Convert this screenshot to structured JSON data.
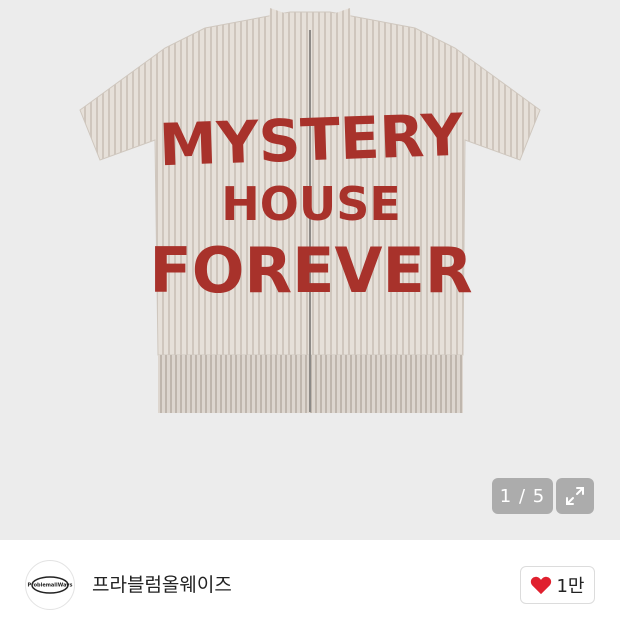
{
  "gallery": {
    "shirt_text_lines": [
      "MYSTERY",
      "HOUSE",
      "FOREVER"
    ],
    "counter": "1 / 5",
    "expand_icon": "expand-icon",
    "colors": {
      "background": "#ececec",
      "shirt": "#e4ddd6",
      "print": "#a8322b"
    }
  },
  "seller": {
    "avatar_text": "ProblemallWays",
    "name": "프라블럼올웨이즈"
  },
  "like": {
    "icon": "heart-icon",
    "count": "1만",
    "color": "#e0202e"
  }
}
